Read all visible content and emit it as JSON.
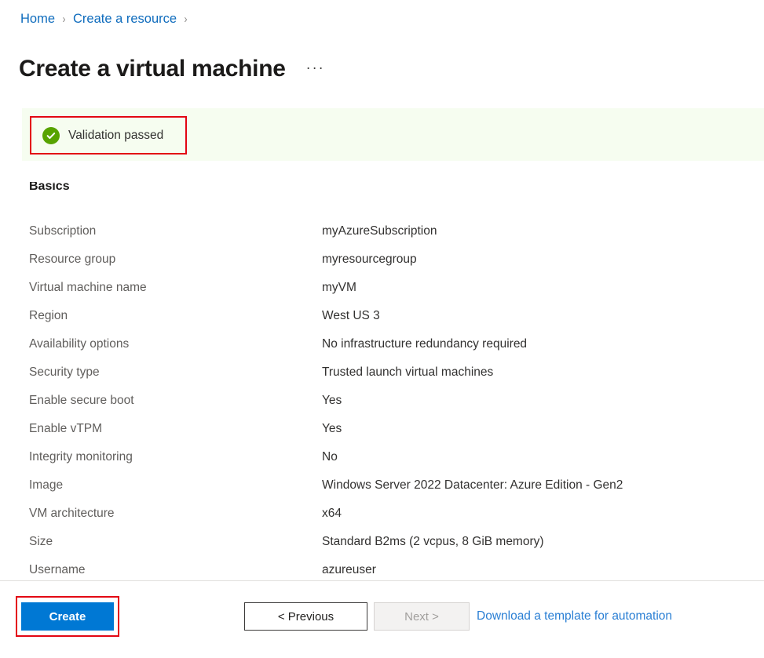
{
  "breadcrumb": {
    "items": [
      {
        "label": "Home",
        "separator": "›"
      },
      {
        "label": "Create a resource",
        "separator": "›"
      }
    ]
  },
  "header": {
    "title": "Create a virtual machine",
    "overflow_menu": "···"
  },
  "validation": {
    "text": "Validation passed",
    "icon": "check-circle-icon",
    "banner_bg": "#f6fdf0",
    "icon_color": "#57a300",
    "highlight_color": "#e30613"
  },
  "summary": {
    "section_title": "Basics",
    "rows": [
      {
        "key": "Subscription",
        "value": "myAzureSubscription"
      },
      {
        "key": "Resource group",
        "value": "myresourcegroup"
      },
      {
        "key": "Virtual machine name",
        "value": "myVM"
      },
      {
        "key": "Region",
        "value": "West US 3"
      },
      {
        "key": "Availability options",
        "value": "No infrastructure redundancy required"
      },
      {
        "key": "Security type",
        "value": "Trusted launch virtual machines"
      },
      {
        "key": "Enable secure boot",
        "value": "Yes"
      },
      {
        "key": "Enable vTPM",
        "value": "Yes"
      },
      {
        "key": "Integrity monitoring",
        "value": "No"
      },
      {
        "key": "Image",
        "value": "Windows Server 2022 Datacenter: Azure Edition - Gen2"
      },
      {
        "key": "VM architecture",
        "value": "x64"
      },
      {
        "key": "Size",
        "value": "Standard B2ms (2 vcpus, 8 GiB memory)"
      },
      {
        "key": "Username",
        "value": "azureuser"
      }
    ]
  },
  "footer": {
    "create_label": "Create",
    "previous_label": "< Previous",
    "next_label": "Next >",
    "next_disabled": true,
    "template_link": "Download a template for automation",
    "primary_color": "#0078d4",
    "link_color": "#2a7fd4"
  }
}
